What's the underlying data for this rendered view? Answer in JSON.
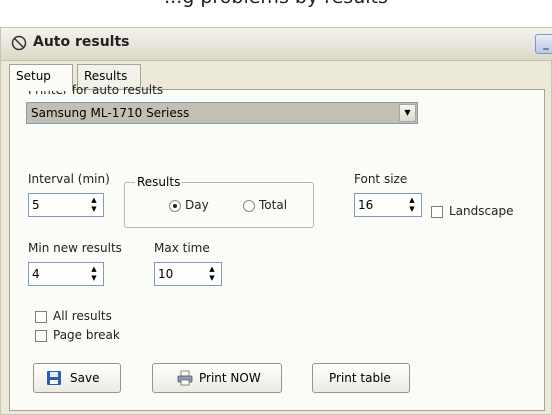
{
  "page_caption": "...g problems by results",
  "window": {
    "title": "Auto results",
    "minimize_label": "_"
  },
  "tabs": [
    {
      "label": "Setup",
      "active": true
    },
    {
      "label": "Results",
      "active": false
    }
  ],
  "setup": {
    "printer_label": "Printer for auto results",
    "printer_value": "Samsung ML-1710 Seriess",
    "interval_label": "Interval (min)",
    "interval_value": "5",
    "results_group_label": "Results",
    "results_options": [
      {
        "label": "Day",
        "selected": true
      },
      {
        "label": "Total",
        "selected": false
      }
    ],
    "font_size_label": "Font size",
    "font_size_value": "16",
    "landscape_label": "Landscape",
    "landscape_checked": false,
    "min_new_results_label": "Min new results",
    "min_new_results_value": "4",
    "max_time_label": "Max time",
    "max_time_value": "10",
    "all_results_label": "All results",
    "all_results_checked": false,
    "page_break_label": "Page break",
    "page_break_checked": false
  },
  "buttons": {
    "save": "Save",
    "print_now": "Print NOW",
    "print_table": "Print table"
  },
  "colors": {
    "window_bg": "#ece9d8",
    "panel_bg": "#fbfbf8",
    "combo_bg": "#c3c0b3",
    "save_icon": "#2b5fb5"
  },
  "icons": {
    "title": "no-entry-icon",
    "save": "floppy-disk-icon",
    "print_now": "printer-icon"
  }
}
